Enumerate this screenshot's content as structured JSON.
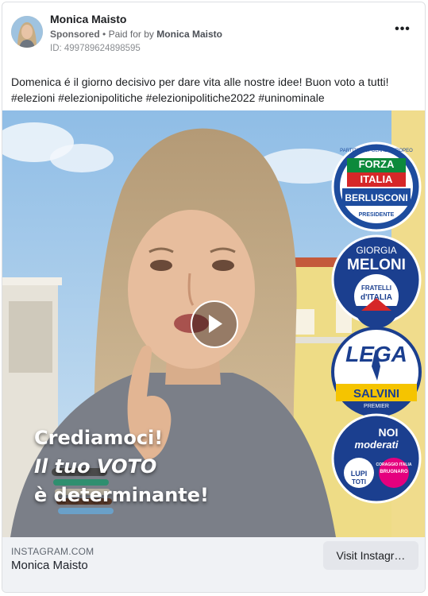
{
  "post": {
    "author": "Monica Maisto",
    "sponsored_label": "Sponsored",
    "paid_for_prefix": "Paid for by",
    "payer": "Monica Maisto",
    "ad_id": "ID: 499789624898595",
    "more_icon": "more-horizontal-icon",
    "caption_line1": "Domenica é il giorno decisivo per dare vita alle nostre idee! Buon voto a tutti!",
    "caption_line2": "#elezioni #elezionipolitiche #elezionipolitiche2022 #uninominale"
  },
  "video": {
    "overlay_line1": "Crediamoci!",
    "overlay_line2": "Il tuo VOTO",
    "overlay_line3": "è determinante!",
    "play_icon": "play-icon",
    "logos": {
      "forza_italia": {
        "ring_text": "PARTITO POPOLARE EUROPEO",
        "line1": "FORZA",
        "line2": "ITALIA",
        "leader": "BERLUSCONI",
        "role": "PRESIDENTE"
      },
      "fratelli_italia": {
        "first_name": "GIORGIA",
        "leader": "MELONI",
        "line1": "FRATELLI",
        "line2": "d'ITALIA"
      },
      "lega": {
        "name": "LEGA",
        "leader": "SALVINI",
        "role": "PREMIER"
      },
      "noi_moderati": {
        "line1": "NOI",
        "line2": "moderati",
        "sub1": "LUPI",
        "sub2": "TOTI",
        "sub3": "CORAGGIO ITALIA",
        "sub4": "BRUGNARO"
      }
    }
  },
  "link_footer": {
    "domain": "INSTAGRAM.COM",
    "title": "Monica Maisto",
    "cta_label": "Visit Instagr…"
  },
  "colors": {
    "sky": "#a9cfee",
    "blue_dark": "#1b3f8f",
    "fi_red": "#d62728",
    "lega_yellow": "#f5c400"
  }
}
